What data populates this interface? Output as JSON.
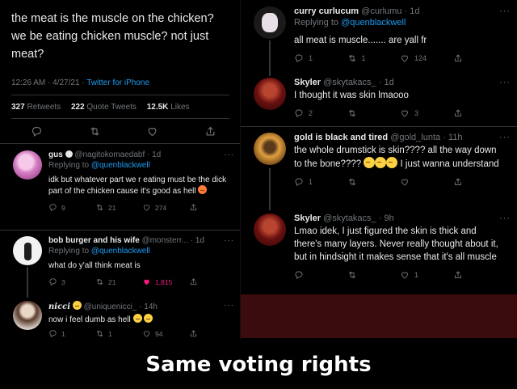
{
  "main_tweet": {
    "lines": [
      "the meat is the muscle on the chicken?",
      "we be eating chicken muscle? not just",
      "meat?"
    ],
    "time": "12:26 AM · 4/27/21 ·",
    "source": "Twitter for iPhone",
    "retweets_count": "327",
    "retweets_label": "Retweets",
    "quotes_count": "222",
    "quotes_label": "Quote Tweets",
    "likes_count": "12.5K",
    "likes_label": "Likes"
  },
  "left_replies": [
    {
      "name": "gus",
      "handle": "@nagitokomaedabf",
      "time": "1d",
      "replying_prefix": "Replying to",
      "replying_to": "@quenblackwell",
      "text": "idk but whatever part we r eating must be the dick part of the chicken cause it's good as hell",
      "replies": "9",
      "retweets": "21",
      "likes": "274"
    },
    {
      "name": "bob burger and his wife",
      "handle": "@monsterr...",
      "time": "1d",
      "replying_prefix": "Replying to",
      "replying_to": "@quenblackwell",
      "text": "what do y'all think meat is",
      "replies": "3",
      "retweets": "21",
      "likes": "1,815"
    },
    {
      "name": "nicci",
      "handle": "@uniquenicci_",
      "time": "14h",
      "text": "now i feel dumb as hell",
      "replies": "1",
      "retweets": "1",
      "likes": "94"
    }
  ],
  "right_replies": [
    {
      "name": "curry curlucum",
      "handle": "@curlumu",
      "time": "1d",
      "replying_prefix": "Replying to",
      "replying_to": "@quenblackwell",
      "text": "all meat is muscle....... are yall fr",
      "replies": "1",
      "retweets": "1",
      "likes": "124"
    },
    {
      "name": "Skyler",
      "handle": "@skytakacs_",
      "time": "1d",
      "text": "I thought it was skin lmaooo",
      "replies": "2",
      "retweets": "",
      "likes": "3"
    },
    {
      "name": "gold is black and tired",
      "handle": "@gold_lunta",
      "time": "11h",
      "text_before": "the whole drumstick is skin???? all the way down to the bone????",
      "text_after": "I just wanna understand",
      "replies": "1",
      "retweets": "",
      "likes": ""
    },
    {
      "name": "Skyler",
      "handle": "@skytakacs_",
      "time": "9h",
      "text": "Lmao idek, I just figured the skin is thick and there's many layers. Never really thought about it, but in hindsight it makes sense that it's all muscle",
      "replies": "",
      "retweets": "",
      "likes": "1"
    }
  ],
  "separator": "·",
  "more_label": "···",
  "caption": "Same voting rights",
  "colors": {
    "background": "#000000",
    "link": "#1d9bf0",
    "muted": "#71767b",
    "like": "#f91880",
    "red_block": "#3a0c0e"
  }
}
